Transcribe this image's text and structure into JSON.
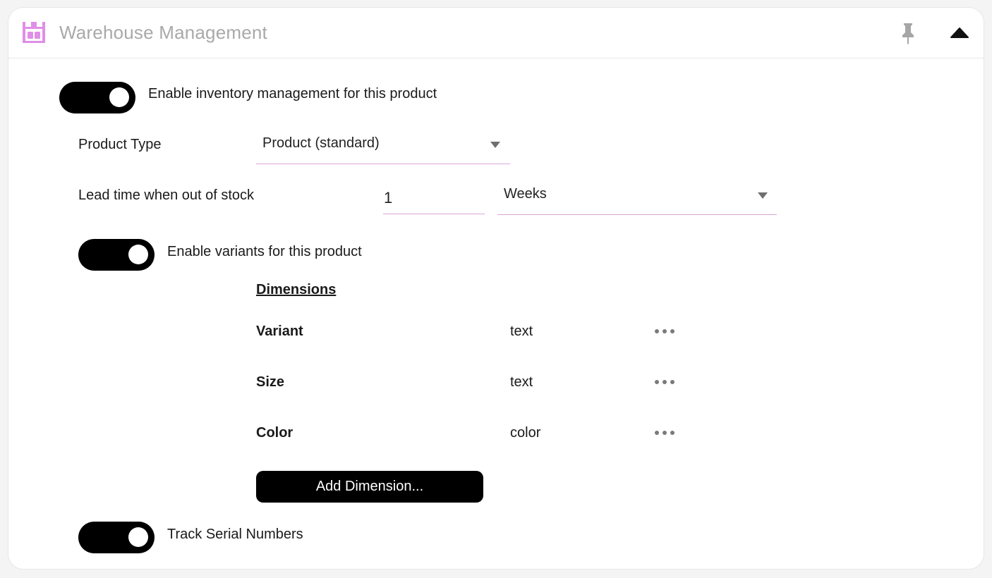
{
  "panel": {
    "title": "Warehouse Management",
    "accent_color": "#e08ee8"
  },
  "inventory": {
    "enabled": true,
    "label": "Enable inventory management for this product"
  },
  "product_type": {
    "label": "Product Type",
    "value": "Product (standard)"
  },
  "lead_time": {
    "label": "Lead time when out of stock",
    "value": "1",
    "unit": "Weeks"
  },
  "variants": {
    "enabled": true,
    "label": "Enable variants for this product",
    "dimensions_heading": "Dimensions",
    "dimensions": [
      {
        "name": "Variant",
        "type": "text"
      },
      {
        "name": "Size",
        "type": "text"
      },
      {
        "name": "Color",
        "type": "color"
      }
    ],
    "add_button_label": "Add Dimension..."
  },
  "serial": {
    "enabled": true,
    "label": "Track Serial Numbers"
  }
}
